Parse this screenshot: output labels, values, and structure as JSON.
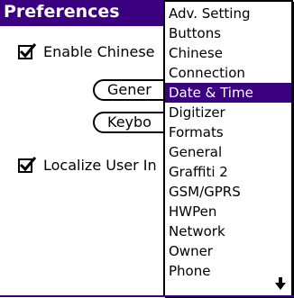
{
  "title": "Preferences",
  "checkboxes": [
    {
      "label": "Enable Chinese",
      "checked": true
    },
    {
      "label": "Localize User In",
      "checked": true
    }
  ],
  "buttons": [
    {
      "label": "Gener"
    },
    {
      "label": "Keybo"
    }
  ],
  "menu": {
    "items": [
      "Adv. Setting",
      "Buttons",
      "Chinese",
      "Connection",
      "Date & Time",
      "Digitizer",
      "Formats",
      "General",
      "Graffiti 2",
      "GSM/GPRS",
      "HWPen",
      "Network",
      "Owner",
      "Phone"
    ],
    "selected": "Date & Time",
    "scroll_icon": "arrow-down-icon"
  },
  "colors": {
    "accent": "#3b007f"
  }
}
